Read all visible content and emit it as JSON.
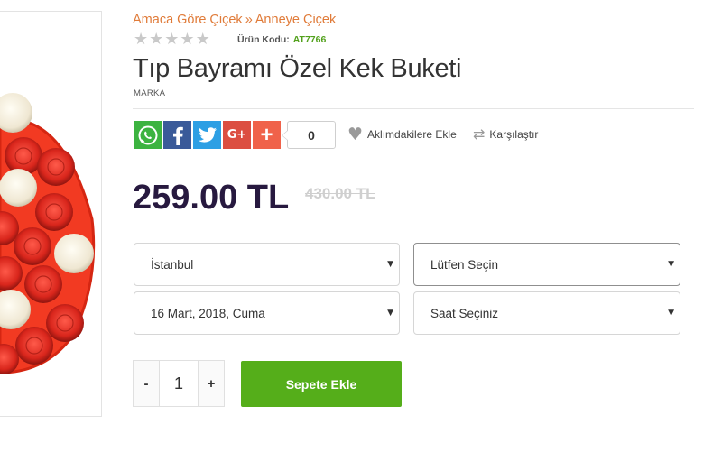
{
  "breadcrumb": {
    "items": [
      "Amaca Göre Çiçek",
      "Anneye Çiçek"
    ],
    "separator": "»"
  },
  "rating": {
    "stars_filled": 0,
    "stars_total": 5,
    "star_glyph": "★"
  },
  "product": {
    "code_label": "Ürün Kodu:",
    "code_value": "AT7766",
    "title": "Tıp Bayramı Özel Kek Buketi",
    "brand": "MARKA",
    "price": "259.00 TL",
    "old_price": "430.00 TL"
  },
  "share": {
    "buttons": [
      {
        "name": "whatsapp",
        "icon": "whatsapp-icon",
        "color": "#3cb340"
      },
      {
        "name": "facebook",
        "icon": "facebook-icon",
        "color": "#3a5a99"
      },
      {
        "name": "twitter",
        "icon": "twitter-icon",
        "color": "#2d9fe4"
      },
      {
        "name": "google-plus",
        "icon": "google-plus-icon",
        "label": "G+",
        "color": "#dc4e41"
      },
      {
        "name": "more",
        "icon": "plus-icon",
        "label": "+",
        "color": "#f0624a"
      }
    ],
    "count": "0"
  },
  "actions": {
    "wishlist_label": "Aklımdakilere Ekle",
    "wishlist_icon": "heart-icon",
    "compare_label": "Karşılaştır",
    "compare_icon": "compare-arrows-icon"
  },
  "selects": {
    "city": "İstanbul",
    "district": "Lütfen Seçin",
    "date": "16 Mart, 2018, Cuma",
    "time": "Saat Seçiniz",
    "caret": "▼"
  },
  "quantity": {
    "minus": "-",
    "value": "1",
    "plus": "+"
  },
  "cart": {
    "add_label": "Sepete Ekle"
  },
  "colors": {
    "accent_orange": "#e07b39",
    "code_green": "#52a11c",
    "price": "#27193f",
    "cart_button": "#55ae1a",
    "cake_red": "#d92b22"
  }
}
